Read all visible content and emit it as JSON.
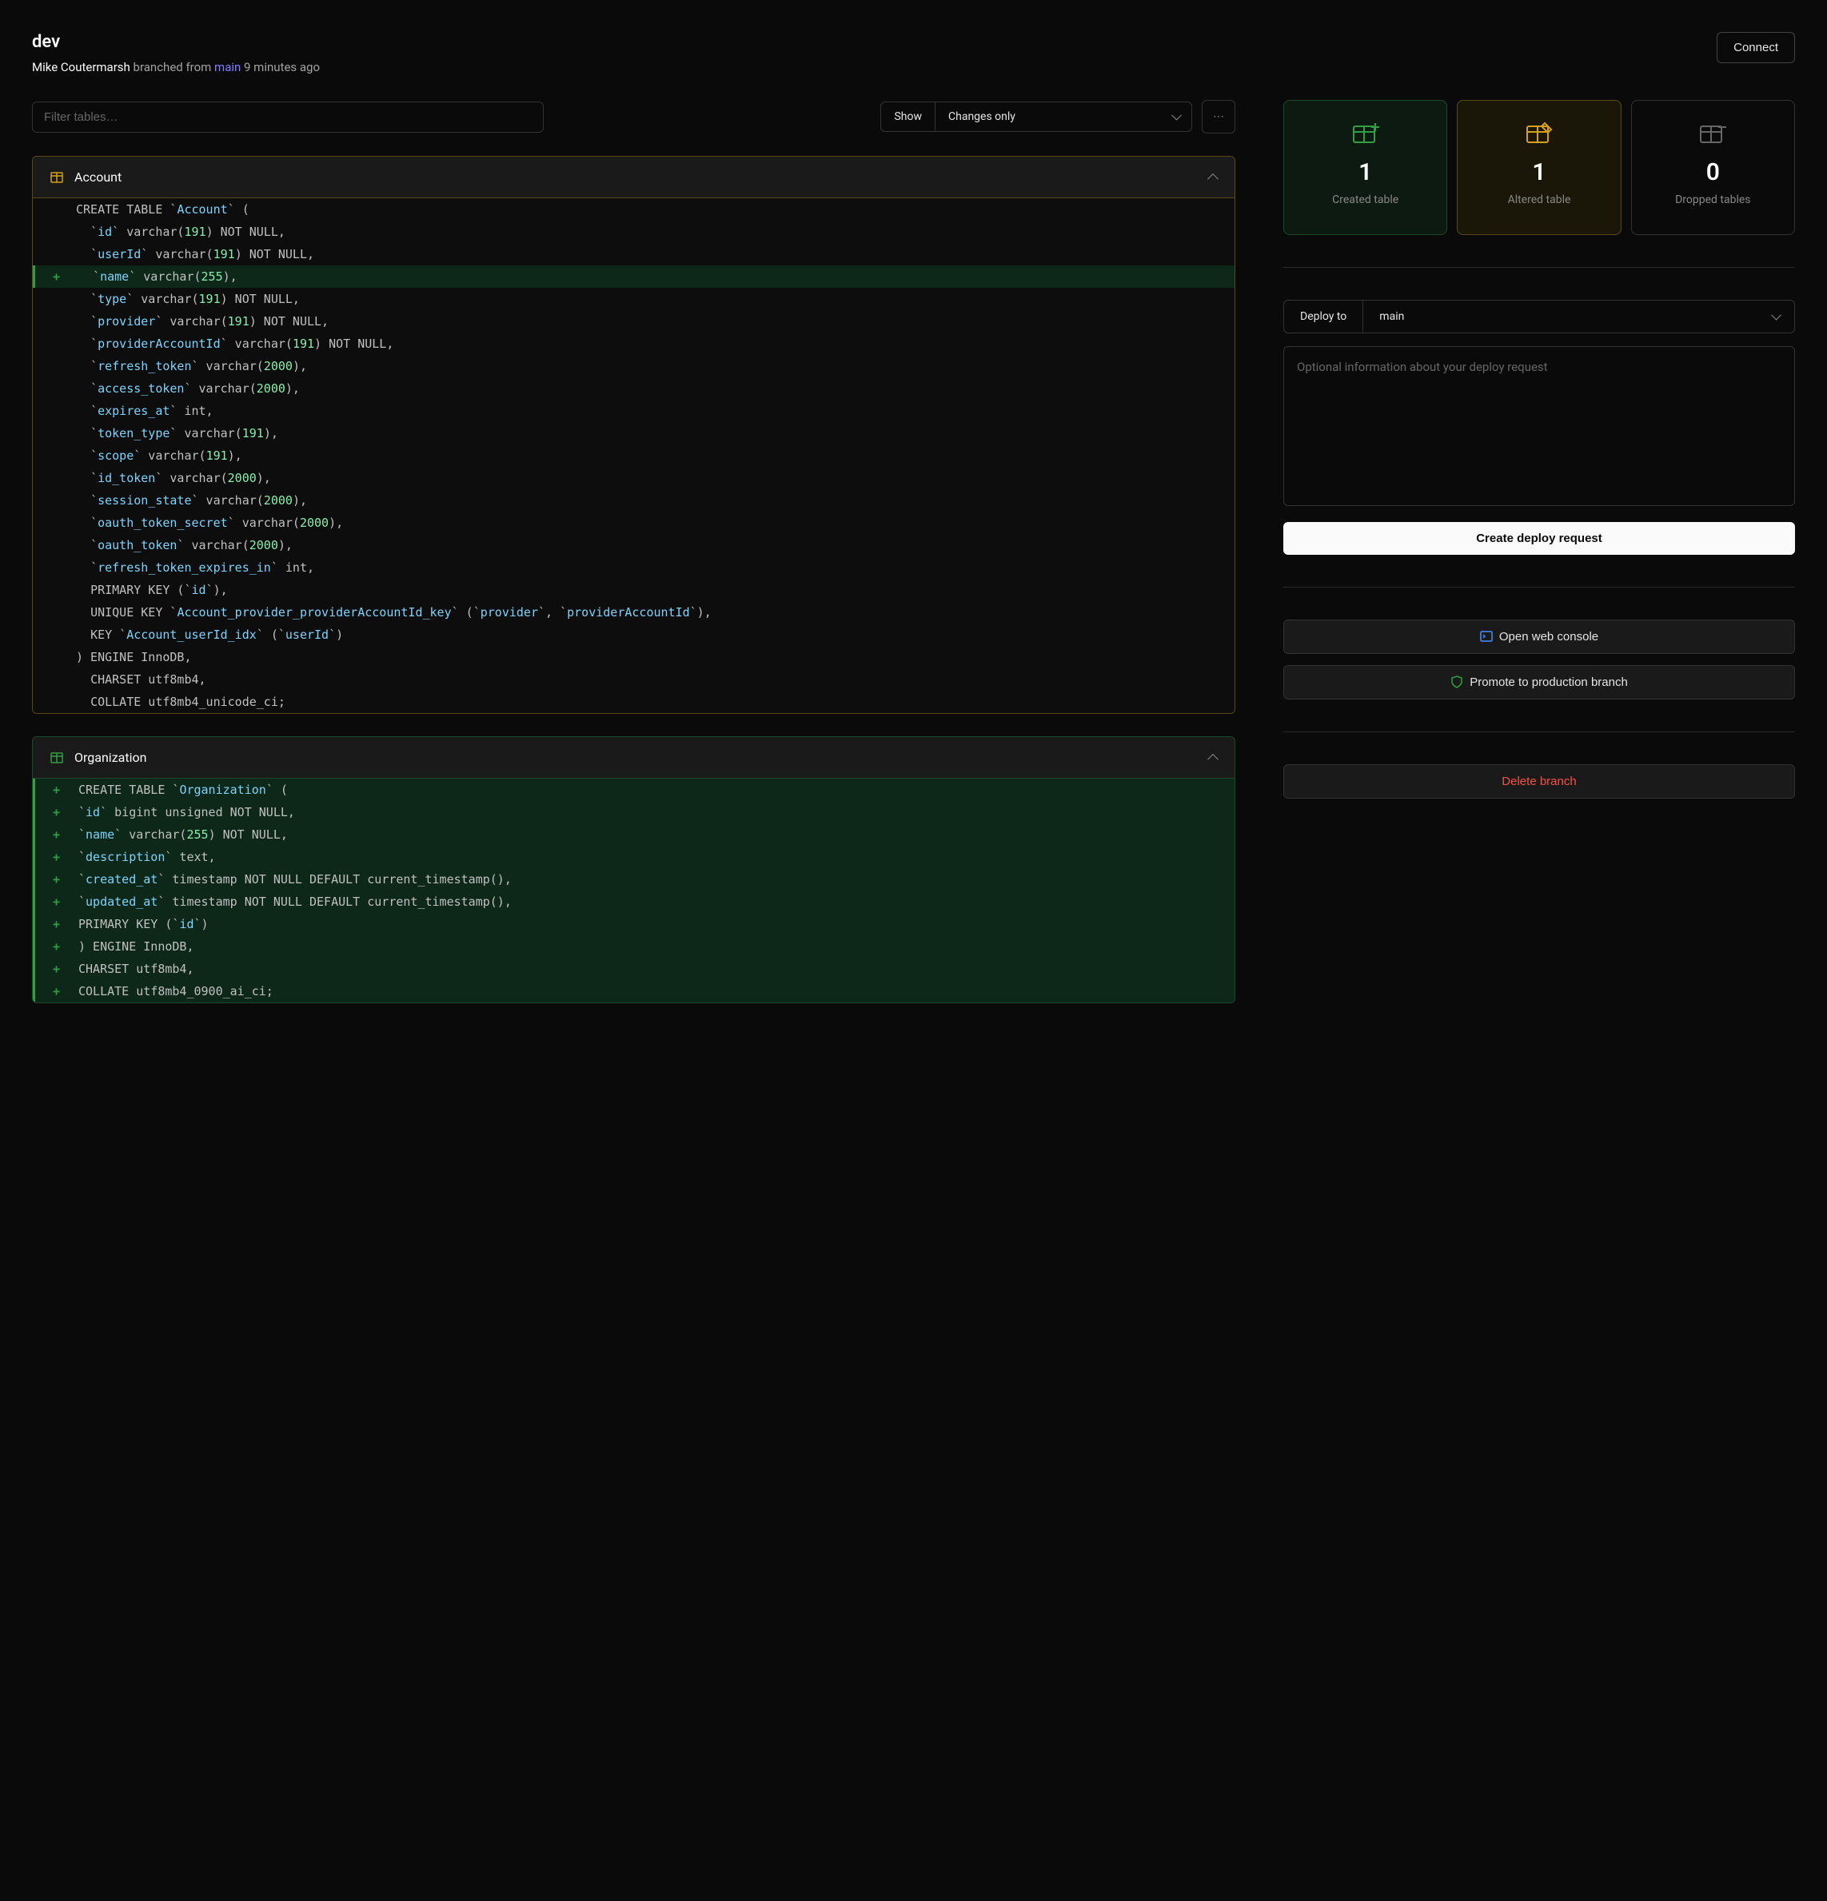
{
  "header": {
    "title": "dev",
    "author": "Mike Coutermarsh",
    "action_text": "branched from",
    "parent_branch": "main",
    "time_ago": "9 minutes ago",
    "connect_label": "Connect"
  },
  "controls": {
    "filter_placeholder": "Filter tables…",
    "show_label": "Show",
    "show_value": "Changes only",
    "more_glyph": "⋯"
  },
  "stats": {
    "created": {
      "count": "1",
      "label": "Created table"
    },
    "altered": {
      "count": "1",
      "label": "Altered table"
    },
    "dropped": {
      "count": "0",
      "label": "Dropped tables"
    }
  },
  "deploy": {
    "deploy_to_label": "Deploy to",
    "deploy_target": "main",
    "request_placeholder": "Optional information about your deploy request",
    "create_request_label": "Create deploy request",
    "open_console_label": "Open web console",
    "promote_label": "Promote to production branch",
    "delete_label": "Delete branch"
  },
  "diffs": [
    {
      "name": "Account",
      "status": "altered",
      "lines": [
        {
          "t": "CREATE TABLE `<c>Account</c>` (",
          "a": false
        },
        {
          "t": "  `<c>id</c>` varchar(<n>191</n>) NOT NULL,",
          "a": false
        },
        {
          "t": "  `<c>userId</c>` varchar(<n>191</n>) NOT NULL,",
          "a": false
        },
        {
          "t": "  `<c>name</c>` varchar(<n>255</n>),",
          "a": true
        },
        {
          "t": "  `<c>type</c>` varchar(<n>191</n>) NOT NULL,",
          "a": false
        },
        {
          "t": "  `<c>provider</c>` varchar(<n>191</n>) NOT NULL,",
          "a": false
        },
        {
          "t": "  `<c>providerAccountId</c>` varchar(<n>191</n>) NOT NULL,",
          "a": false
        },
        {
          "t": "  `<c>refresh_token</c>` varchar(<n>2000</n>),",
          "a": false
        },
        {
          "t": "  `<c>access_token</c>` varchar(<n>2000</n>),",
          "a": false
        },
        {
          "t": "  `<c>expires_at</c>` int,",
          "a": false
        },
        {
          "t": "  `<c>token_type</c>` varchar(<n>191</n>),",
          "a": false
        },
        {
          "t": "  `<c>scope</c>` varchar(<n>191</n>),",
          "a": false
        },
        {
          "t": "  `<c>id_token</c>` varchar(<n>2000</n>),",
          "a": false
        },
        {
          "t": "  `<c>session_state</c>` varchar(<n>2000</n>),",
          "a": false
        },
        {
          "t": "  `<c>oauth_token_secret</c>` varchar(<n>2000</n>),",
          "a": false
        },
        {
          "t": "  `<c>oauth_token</c>` varchar(<n>2000</n>),",
          "a": false
        },
        {
          "t": "  `<c>refresh_token_expires_in</c>` int,",
          "a": false
        },
        {
          "t": "  PRIMARY KEY (`<c>id</c>`),",
          "a": false
        },
        {
          "t": "  UNIQUE KEY `<c>Account_provider_providerAccountId_key</c>` (`<c>provider</c>`, `<c>providerAccountId</c>`),",
          "a": false
        },
        {
          "t": "  KEY `<c>Account_userId_idx</c>` (`<c>userId</c>`)",
          "a": false
        },
        {
          "t": ") ENGINE InnoDB,",
          "a": false
        },
        {
          "t": "  CHARSET utf8mb4,",
          "a": false
        },
        {
          "t": "  COLLATE utf8mb4_unicode_ci;",
          "a": false
        }
      ]
    },
    {
      "name": "Organization",
      "status": "created",
      "lines": [
        {
          "t": "CREATE TABLE `<c>Organization</c>` (",
          "a": true
        },
        {
          "t": "`<c>id</c>` bigint unsigned NOT NULL,",
          "a": true
        },
        {
          "t": "`<c>name</c>` varchar(<n>255</n>) NOT NULL,",
          "a": true
        },
        {
          "t": "`<c>description</c>` text,",
          "a": true
        },
        {
          "t": "`<c>created_at</c>` timestamp NOT NULL DEFAULT current_timestamp(),",
          "a": true
        },
        {
          "t": "`<c>updated_at</c>` timestamp NOT NULL DEFAULT current_timestamp(),",
          "a": true
        },
        {
          "t": "PRIMARY KEY (`<c>id</c>`)",
          "a": true
        },
        {
          "t": ") ENGINE InnoDB,",
          "a": true
        },
        {
          "t": "CHARSET utf8mb4,",
          "a": true
        },
        {
          "t": "COLLATE utf8mb4_0900_ai_ci;",
          "a": true
        }
      ]
    }
  ]
}
